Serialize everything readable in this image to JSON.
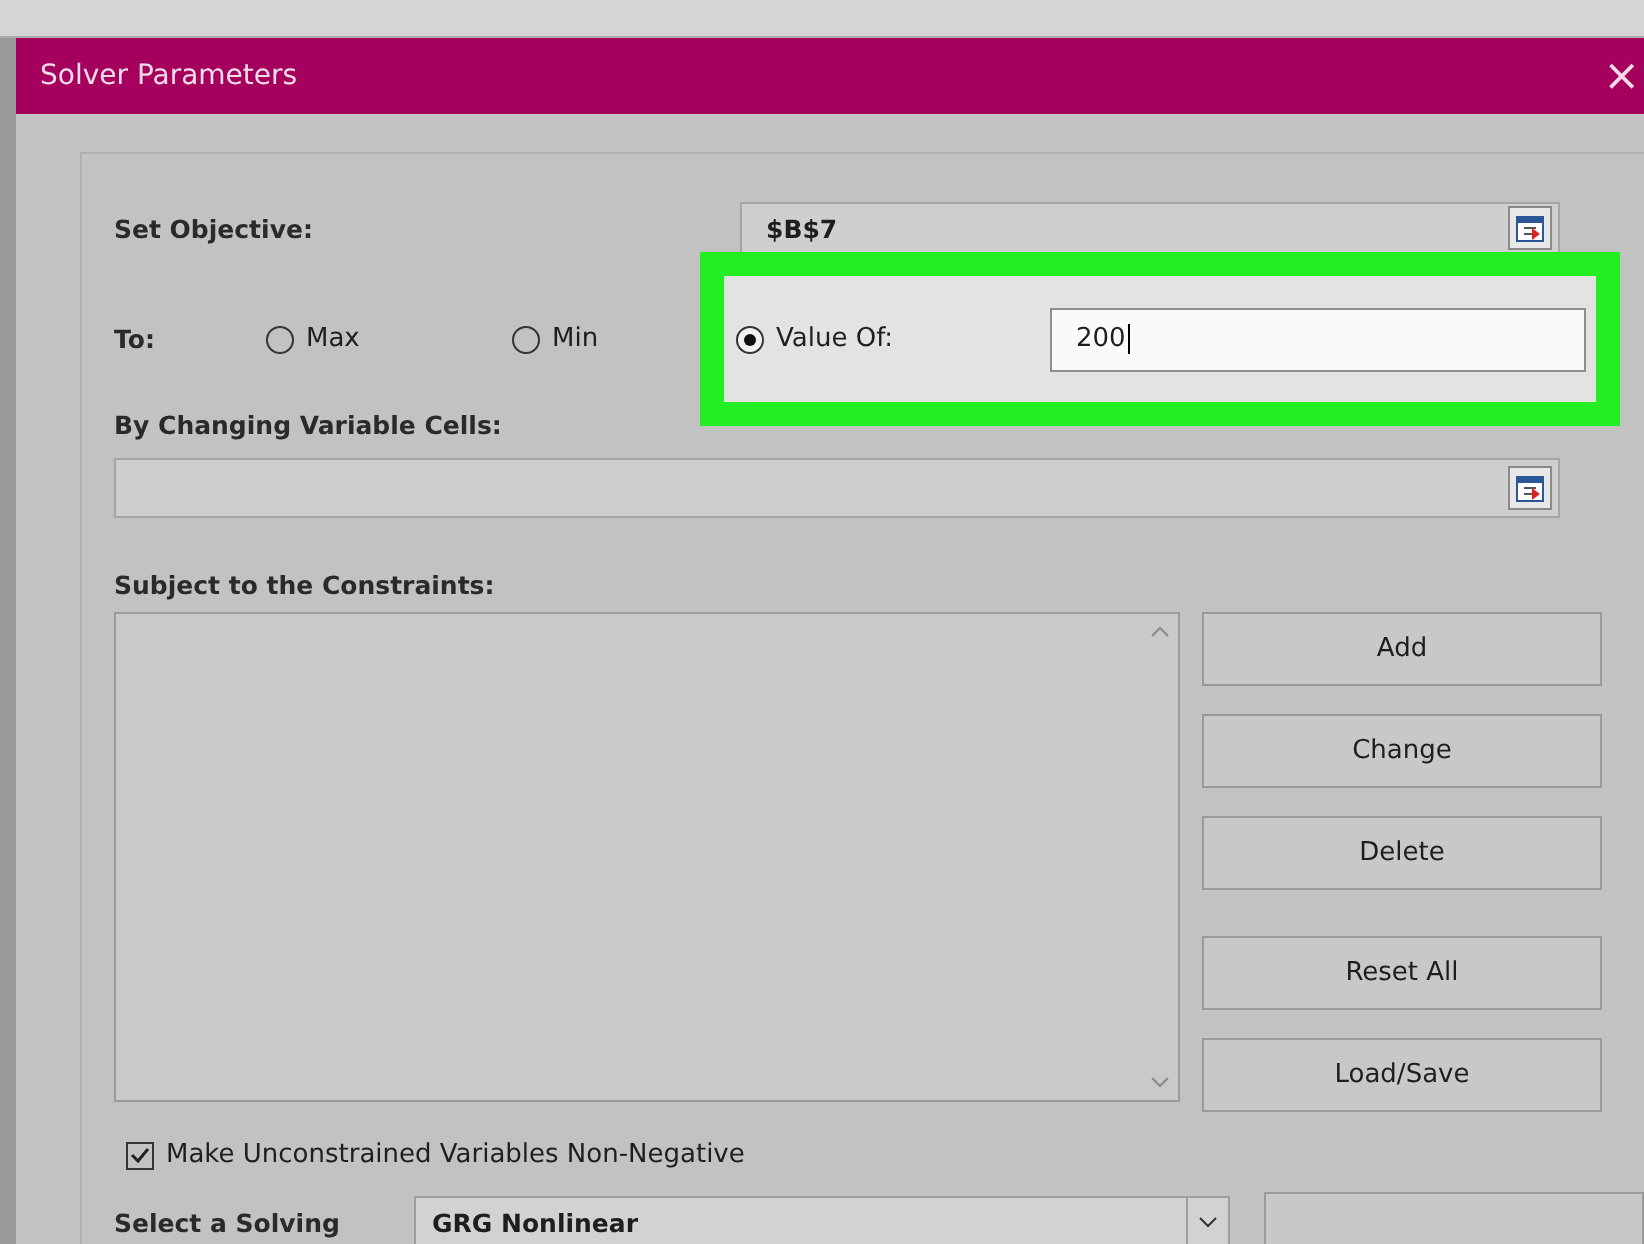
{
  "window": {
    "title": "Solver Parameters",
    "close": "×"
  },
  "objective": {
    "label": "Set Objective:",
    "value": "$B$7"
  },
  "to": {
    "label": "To:",
    "options": [
      {
        "kind": "plain",
        "label": "Max",
        "selected": false
      },
      {
        "kind": "plain",
        "label": "Min",
        "selected": false
      },
      {
        "kind": "value",
        "label": "Value Of:",
        "selected": true,
        "highlighted": true,
        "value": "200"
      }
    ]
  },
  "variable_cells": {
    "label": "By Changing Variable Cells:"
  },
  "constraints": {
    "label": "Subject to the Constraints:"
  },
  "buttons": [
    {
      "label": "Add"
    },
    {
      "label": "Change"
    },
    {
      "label": "Delete"
    },
    {
      "label": "Reset All"
    },
    {
      "label": "Load/Save"
    }
  ],
  "non_negative": {
    "label": "Make Unconstrained Variables Non-Negative",
    "checked": true
  },
  "solving": {
    "label": "Select a Solving",
    "value": "GRG Nonlinear"
  }
}
